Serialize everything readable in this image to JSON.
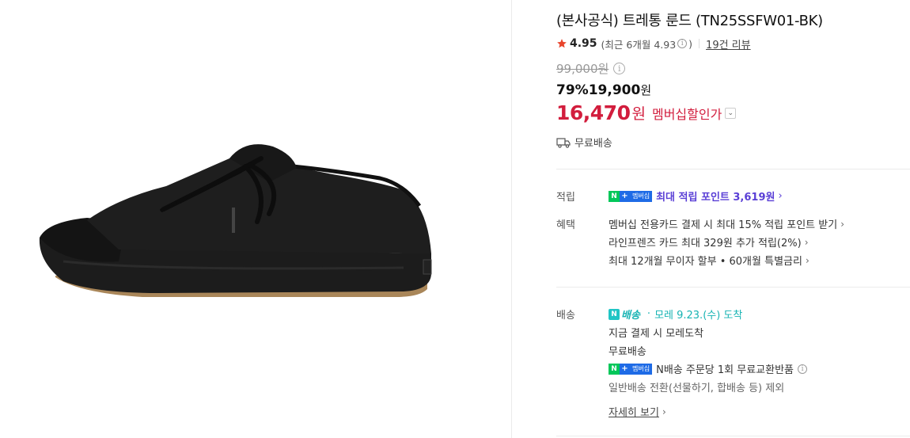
{
  "product": {
    "title": "(본사공식) 트레통 룬드 (TN25SSFW01-BK)",
    "image_alt": "black canvas sneaker"
  },
  "rating": {
    "score": "4.95",
    "recent": "(최근 6개월 4.93",
    "recent_close": ")",
    "reviews_link": "19건 리뷰",
    "star_color": "#e8442c"
  },
  "price": {
    "original": "99,000원",
    "discount_percent": "79%",
    "sale_price": "19,900",
    "sale_won": "원",
    "member_price": "16,470",
    "member_won": "원",
    "member_label": "멤버십할인가"
  },
  "shipping": {
    "label": "무료배송"
  },
  "points": {
    "section_label": "적립",
    "text": "최대 적립 포인트 3,619원",
    "badge_n": "N",
    "badge_plus": "+",
    "badge_member": "멤버십"
  },
  "benefits": {
    "section_label": "혜택",
    "items": [
      "멤버십 전용카드 결제 시 최대 15% 적립 포인트 받기",
      "라인프렌즈 카드 최대 329원 추가 적립(2%)",
      "최대 12개월 무이자 할부 • 60개월 특별금리"
    ]
  },
  "delivery": {
    "section_label": "배송",
    "nbaesong_n": "N",
    "nbaesong_text": "배송",
    "arrival": "모레 9.23.(수) 도착",
    "line1": "지금 결제 시 모레도착",
    "line2": "무료배송",
    "exchange": "N배송 주문당 1회 무료교환반품",
    "excluded": "일반배송 전환(선물하기, 합배송 등) 제외",
    "detail_link": "자세히 보기"
  },
  "colors": {
    "accent_red": "#d21d3d",
    "point_purple": "#5a3fd6",
    "naver_green": "#03c75a",
    "nbaesong_teal": "#17b3b3"
  }
}
